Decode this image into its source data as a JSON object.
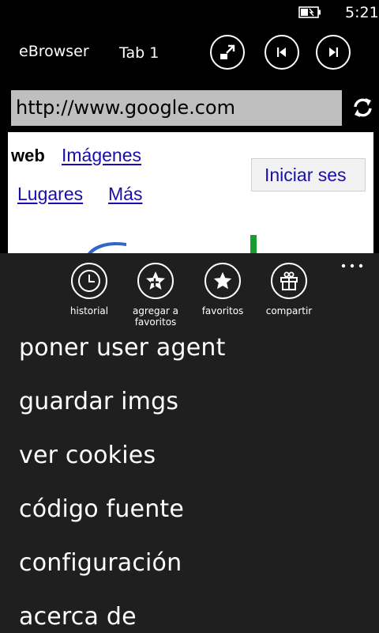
{
  "status_bar": {
    "time": "5:21",
    "battery_icon": "battery-charging-icon"
  },
  "header": {
    "app_title": "eBrowser",
    "tab_label": "Tab 1",
    "buttons": [
      {
        "name": "fullscreen",
        "icon": "expand-arrow-icon"
      },
      {
        "name": "back",
        "icon": "previous-icon"
      },
      {
        "name": "forward",
        "icon": "next-icon"
      }
    ]
  },
  "address_bar": {
    "url": "http://www.google.com",
    "refresh_icon": "refresh-icon"
  },
  "webpage": {
    "nav_active": "web",
    "link_images": "Imágenes",
    "link_places": "Lugares",
    "link_more": "Más",
    "signin_button": "Iniciar ses"
  },
  "app_bar": {
    "buttons": [
      {
        "label": "historial",
        "icon": "clock-icon"
      },
      {
        "label_line1": "agregar a",
        "label_line2": "favoritos",
        "icon": "add-star-icon"
      },
      {
        "label": "favoritos",
        "icon": "star-icon"
      },
      {
        "label": "compartir",
        "icon": "gift-icon"
      }
    ],
    "more_icon": "ellipsis-icon",
    "menu_items": [
      "poner user agent",
      "guardar imgs",
      "ver cookies",
      "código fuente",
      "configuración",
      "acerca de"
    ]
  },
  "colors": {
    "background": "#000000",
    "app_bar": "#1f1f1f",
    "url_box": "#bfbfbf",
    "link": "#1a0dab"
  }
}
